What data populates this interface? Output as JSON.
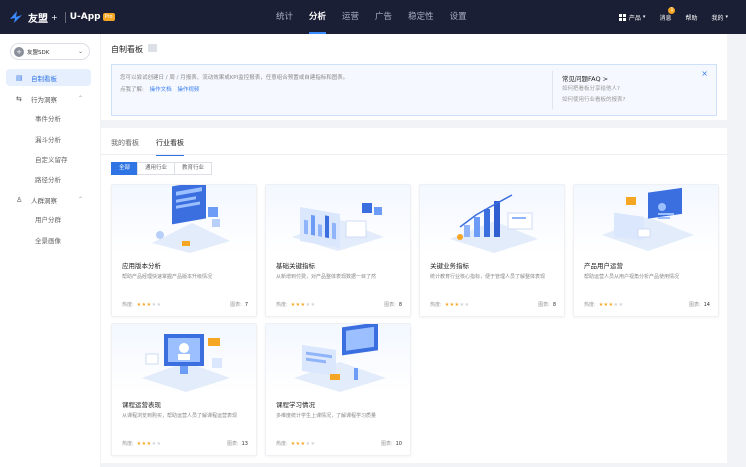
{
  "brand": {
    "name_cn": "友盟",
    "plus": "+",
    "product": "U-App",
    "badge": "Pro"
  },
  "nav": {
    "items": [
      {
        "label": "统计",
        "active": false
      },
      {
        "label": "分析",
        "active": true
      },
      {
        "label": "运营",
        "active": false
      },
      {
        "label": "广告",
        "active": false
      },
      {
        "label": "稳定性",
        "active": false
      },
      {
        "label": "设置",
        "active": false
      }
    ],
    "right": {
      "product": "产品",
      "messages": "消息",
      "message_count": "1",
      "help": "帮助",
      "mine": "我的"
    }
  },
  "sidebar": {
    "app": {
      "icon": "+",
      "name": "友盟SDK"
    },
    "items": [
      {
        "label": "自制看板",
        "icon": "dashboard-icon",
        "active": true
      },
      {
        "label": "行为洞察",
        "icon": "behavior-icon",
        "group": true
      },
      {
        "label": "事件分析"
      },
      {
        "label": "漏斗分析"
      },
      {
        "label": "自定义留存"
      },
      {
        "label": "路径分析"
      },
      {
        "label": "人群洞察",
        "icon": "user-icon",
        "group": true
      },
      {
        "label": "用户分群"
      },
      {
        "label": "全景画像"
      }
    ]
  },
  "header": {
    "title": "自制看板",
    "info": {
      "text": "您可以尝试创建日 / 周 / 月报表、流动效果或KPI监控报表，任意组合预置或自建指标和图表。",
      "learn_prefix": "点我了解:",
      "doc_link": "操作文档",
      "video_link": "操作视频",
      "faq_title": "常见问题FAQ >",
      "faq_q1": "如何把看板分享给他人?",
      "faq_q2": "如何使用行业看板的报表?"
    }
  },
  "tabs": [
    {
      "label": "我的看板",
      "active": false
    },
    {
      "label": "行业看板",
      "active": true
    }
  ],
  "filters": [
    {
      "label": "全部",
      "active": true
    },
    {
      "label": "通用行业",
      "active": false
    },
    {
      "label": "教育行业",
      "active": false
    }
  ],
  "cards": [
    {
      "title": "应用版本分析",
      "desc": "帮助产品经理快速掌握产品版本升级情况",
      "heat_label": "热度:",
      "heat": 3,
      "count_label": "图表:",
      "count": "7"
    },
    {
      "title": "基础关键指标",
      "desc": "从新增到付费，对产品整体表现数据一目了然",
      "heat_label": "热度:",
      "heat": 3,
      "count_label": "图表:",
      "count": "8"
    },
    {
      "title": "关键业务指标",
      "desc": "统计教育行业核心指标，便于管理人员了解整体表现",
      "heat_label": "热度:",
      "heat": 3,
      "count_label": "图表:",
      "count": "8"
    },
    {
      "title": "产品用户运营",
      "desc": "帮助运营人员从用户视角分析产品使用情况",
      "heat_label": "热度:",
      "heat": 3,
      "count_label": "图表:",
      "count": "14"
    },
    {
      "title": "课程运营表现",
      "desc": "从课程浏览到购买，帮助运营人员了解课程运营表现",
      "heat_label": "热度:",
      "heat": 3,
      "count_label": "图表:",
      "count": "13"
    },
    {
      "title": "课程学习情况",
      "desc": "多维度统计学生上课情况，了解课程学习质量",
      "heat_label": "热度:",
      "heat": 3,
      "count_label": "图表:",
      "count": "10"
    }
  ],
  "colors": {
    "topbar": "#1b1f35",
    "accent": "#2f74e4",
    "star": "#f5a623"
  }
}
